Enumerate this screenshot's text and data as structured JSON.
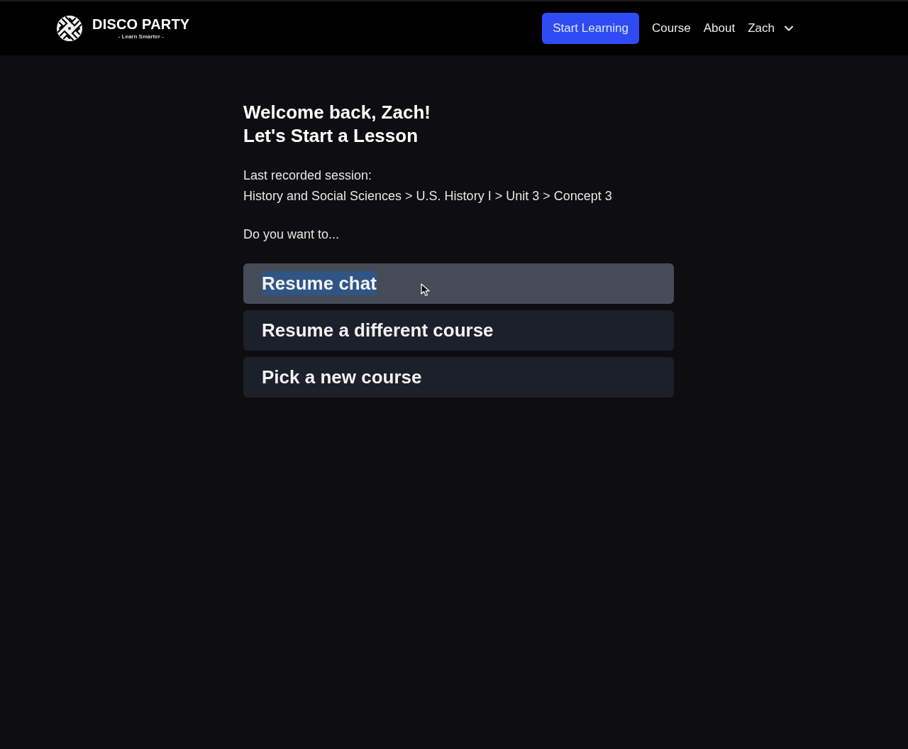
{
  "header": {
    "logo": {
      "title": "DISCO PARTY",
      "tagline": "- Learn Smarter -"
    },
    "nav": {
      "cta": "Start Learning",
      "links": [
        "Course",
        "About"
      ],
      "user": {
        "name": "Zach",
        "menu_expanded": false
      }
    }
  },
  "main": {
    "greeting": "Welcome back, Zach!",
    "heading": "Let's Start a Lesson",
    "session_label": "Last recorded session:",
    "session_path": "History and Social Sciences > U.S. History I > Unit 3 > Concept 3",
    "prompt": "Do you want to...",
    "options": [
      {
        "label": "Resume chat",
        "hovered": true,
        "text_selected": true
      },
      {
        "label": "Resume a different course",
        "hovered": false,
        "text_selected": false
      },
      {
        "label": "Pick a new course",
        "hovered": false,
        "text_selected": false
      }
    ]
  }
}
